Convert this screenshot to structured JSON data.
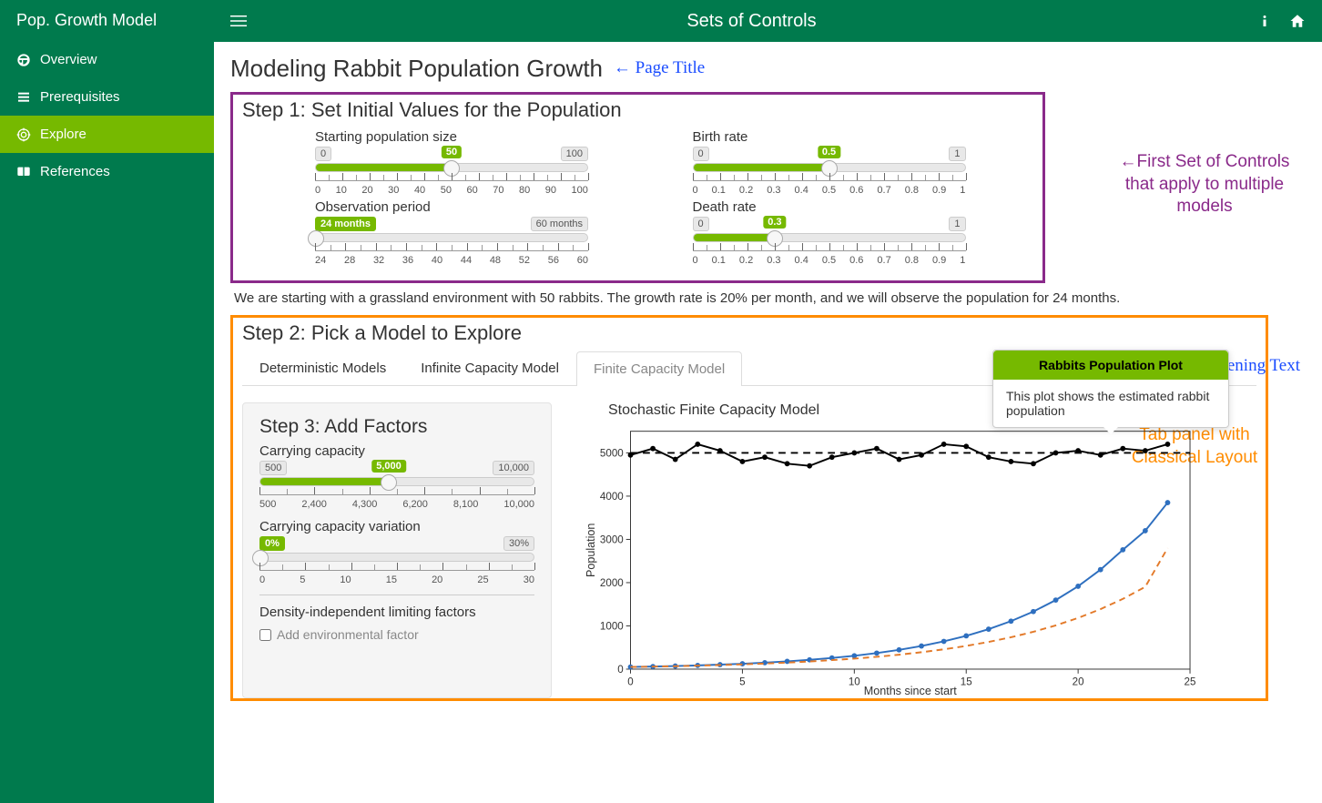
{
  "sidebar": {
    "title": "Pop. Growth Model",
    "items": [
      {
        "label": "Overview",
        "icon": "dashboard"
      },
      {
        "label": "Prerequisites",
        "icon": "list"
      },
      {
        "label": "Explore",
        "icon": "target"
      },
      {
        "label": "References",
        "icon": "book"
      }
    ],
    "active_index": 2
  },
  "topbar": {
    "title": "Sets of Controls"
  },
  "page": {
    "title": "Modeling Rabbit Population Growth"
  },
  "annotations": {
    "page_title": "← Page Title",
    "first_set": "←First Set of Controls that apply to multiple models",
    "opening_text": "↓ Opening Text",
    "tab_panel": "Tab panel with Classical Layout"
  },
  "step1": {
    "title": "Step 1: Set Initial Values for the Population",
    "controls": {
      "start_pop": {
        "label": "Starting population size",
        "min": "0",
        "max": "100",
        "value": "50",
        "badge": "50",
        "fill_pct": 50,
        "ticks": [
          "0",
          "10",
          "20",
          "30",
          "40",
          "50",
          "60",
          "70",
          "80",
          "90",
          "100"
        ]
      },
      "obs_period": {
        "label": "Observation period",
        "min_label": "24 months",
        "max_label": "60 months",
        "value": "24",
        "badge": "24 months",
        "fill_pct": 0,
        "ticks": [
          "24",
          "28",
          "32",
          "36",
          "40",
          "44",
          "48",
          "52",
          "56",
          "60"
        ]
      },
      "birth_rate": {
        "label": "Birth rate",
        "min": "0",
        "max": "1",
        "value": "0.5",
        "badge": "0.5",
        "fill_pct": 50,
        "ticks": [
          "0",
          "0.1",
          "0.2",
          "0.3",
          "0.4",
          "0.5",
          "0.6",
          "0.7",
          "0.8",
          "0.9",
          "1"
        ]
      },
      "death_rate": {
        "label": "Death rate",
        "min": "0",
        "max": "1",
        "value": "0.3",
        "badge": "0.3",
        "fill_pct": 30,
        "ticks": [
          "0",
          "0.1",
          "0.2",
          "0.3",
          "0.4",
          "0.5",
          "0.6",
          "0.7",
          "0.8",
          "0.9",
          "1"
        ]
      }
    }
  },
  "opening_text": "We are starting with a grassland environment with 50 rabbits. The growth rate is 20% per month, and we will observe the population for 24 months.",
  "step2": {
    "title": "Step 2: Pick a Model to Explore",
    "tabs": [
      "Deterministic Models",
      "Infinite Capacity Model",
      "Finite Capacity Model"
    ],
    "active_tab": 2
  },
  "step3": {
    "title": "Step 3: Add Factors",
    "controls": {
      "capacity": {
        "label": "Carrying capacity",
        "min": "500",
        "max": "10,000",
        "value": "5000",
        "badge": "5,000",
        "fill_pct": 47,
        "ticks": [
          "500",
          "2,400",
          "4,300",
          "6,200",
          "8,100",
          "10,000"
        ]
      },
      "variation": {
        "label": "Carrying capacity variation",
        "min": "0%",
        "max": "30%",
        "value": "0",
        "badge": "0%",
        "fill_pct": 0,
        "ticks": [
          "0",
          "5",
          "10",
          "15",
          "20",
          "25",
          "30"
        ]
      }
    },
    "limiting_label": "Density-independent limiting factors",
    "env_checkbox": "Add environmental factor"
  },
  "tooltip": {
    "title": "Rabbits Population Plot",
    "body": "This plot shows the estimated rabbit population"
  },
  "plot": {
    "title": "Stochastic Finite Capacity Model",
    "xlabel": "Months since start"
  },
  "chart_data": {
    "type": "line",
    "title": "Stochastic Finite Capacity Model",
    "xlabel": "Months since start",
    "ylabel": "Population",
    "xlim": [
      0,
      25
    ],
    "ylim": [
      0,
      5500
    ],
    "xticks": [
      0,
      5,
      10,
      15,
      20,
      25
    ],
    "yticks": [
      0,
      1000,
      2000,
      3000,
      4000,
      5000
    ],
    "hline": 5000,
    "series": [
      {
        "name": "carrying_capacity_stochastic",
        "color": "#000",
        "style": "solid-dots",
        "x": [
          0,
          1,
          2,
          3,
          4,
          5,
          6,
          7,
          8,
          9,
          10,
          11,
          12,
          13,
          14,
          15,
          16,
          17,
          18,
          19,
          20,
          21,
          22,
          23,
          24
        ],
        "y": [
          4950,
          5100,
          4850,
          5200,
          5050,
          4800,
          4900,
          4750,
          4700,
          4900,
          5000,
          5100,
          4850,
          4950,
          5200,
          5150,
          4900,
          4800,
          4750,
          5000,
          5050,
          4950,
          5100,
          5050,
          5200
        ]
      },
      {
        "name": "population_blue",
        "color": "#2e6fbf",
        "style": "solid-dots",
        "x": [
          0,
          1,
          2,
          3,
          4,
          5,
          6,
          7,
          8,
          9,
          10,
          11,
          12,
          13,
          14,
          15,
          16,
          17,
          18,
          19,
          20,
          21,
          22,
          23,
          24
        ],
        "y": [
          50,
          60,
          72,
          86,
          104,
          124,
          149,
          179,
          215,
          258,
          309,
          371,
          446,
          535,
          642,
          770,
          924,
          1109,
          1331,
          1597,
          1916,
          2300,
          2760,
          3200,
          3850
        ]
      },
      {
        "name": "population_orange_dashed",
        "color": "#e37a2a",
        "style": "dashed",
        "x": [
          0,
          1,
          2,
          3,
          4,
          5,
          6,
          7,
          8,
          9,
          10,
          11,
          12,
          13,
          14,
          15,
          16,
          17,
          18,
          19,
          20,
          21,
          22,
          23,
          24
        ],
        "y": [
          50,
          58,
          68,
          80,
          94,
          110,
          129,
          151,
          177,
          208,
          243,
          285,
          334,
          391,
          458,
          537,
          629,
          737,
          863,
          1011,
          1184,
          1387,
          1624,
          1903,
          2800
        ]
      }
    ]
  }
}
